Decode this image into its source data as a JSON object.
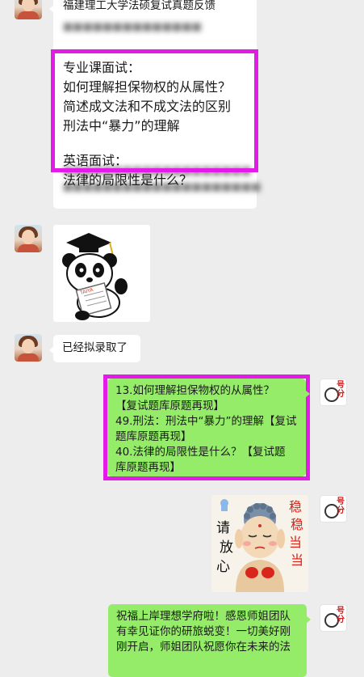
{
  "messages": {
    "m1": {
      "title": "福建理工大学法硕复试真题反馈",
      "blur_top": "■■■■■■■■■■■■■■",
      "professional_label": "专业课面试：",
      "q1": "如何理解担保物权的从属性？",
      "q2": "简述成文法和不成文法的区别",
      "q3": "刑法中“暴力”的理解",
      "english_label": "英语面试：",
      "q4": "法律的局限性是什么？",
      "blur_bottom1": "■■■■■■■■■■■■■■■■■■■",
      "blur_bottom2": "■■■■■■■■■■■■■■■■■■■■"
    },
    "m3": {
      "text": "已经拟录取了"
    },
    "m4": {
      "line1": "13.如何理解担保物权的从属性？",
      "line2": "【复试题库原题再现】",
      "line3": "49.刑法：刑法中“暴力”的理解【复试",
      "line4": "题库原题再现】",
      "line5": "40.法律的局限性是什么？【复试题",
      "line6": "库原题再现】"
    },
    "m6": {
      "line1": "祝福上岸理想学府啦！感恩师姐团队",
      "line2": "有幸见证你的研旅蜕变！一切美好刚",
      "line3": "刚开启，师姐团队祝愿你在未来的法"
    }
  },
  "stickers": {
    "panda": {
      "label": "TAIYA"
    },
    "buddha": {
      "left_text_1": "请",
      "left_text_2": "放",
      "left_text_3": "心",
      "right_text_1": "稳",
      "right_text_2": "稳",
      "right_text_3": "当",
      "right_text_4": "当"
    }
  },
  "avatar_right_mark": "号\n分",
  "colors": {
    "highlight": "#e21be6",
    "sent_bubble": "#95ec69",
    "received_bubble": "#ffffff",
    "background": "#ededed"
  }
}
